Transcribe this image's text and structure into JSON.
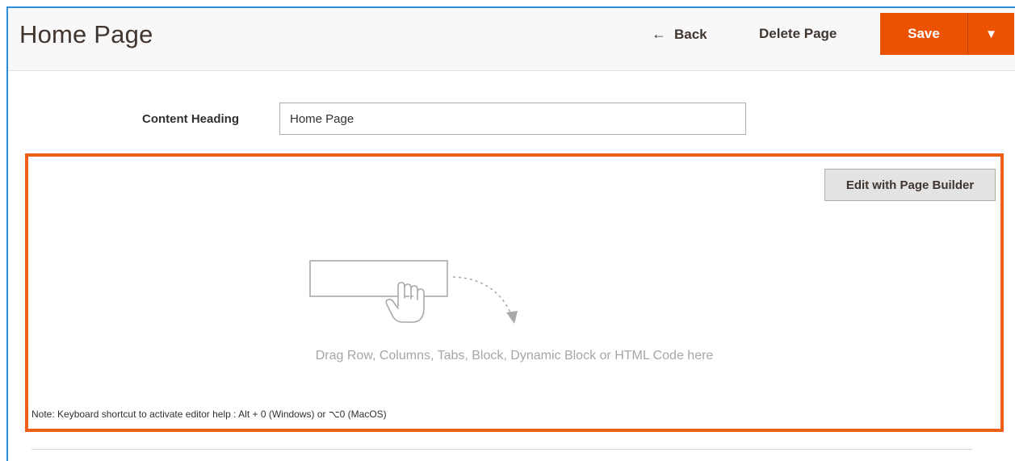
{
  "header": {
    "title": "Home Page",
    "back_arrow": "←",
    "back_label": "Back",
    "delete_label": "Delete Page",
    "save_label": "Save",
    "save_toggle_glyph": "▼"
  },
  "form": {
    "content_heading_label": "Content Heading",
    "content_heading_value": "Home Page"
  },
  "page_builder": {
    "edit_button_label": "Edit with Page Builder",
    "placeholder_text": "Drag Row, Columns, Tabs, Block, Dynamic Block or HTML Code here",
    "note_text": "Note: Keyboard shortcut to activate editor help : Alt + 0 (Windows) or ⌥0 (MacOS)",
    "placeholder_icon": "drag-hand-icon"
  },
  "colors": {
    "accent": "#eb5202",
    "highlight_border": "#eb5f16",
    "frame_border": "#2a8fd6",
    "placeholder_text": "#a6a6a6"
  }
}
